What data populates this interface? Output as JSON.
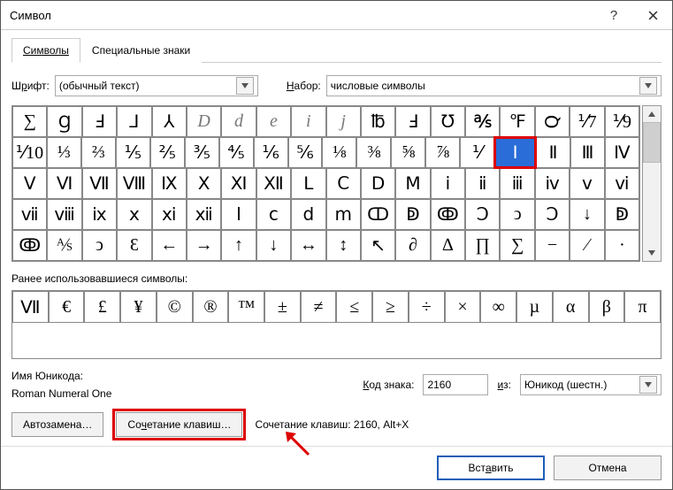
{
  "title": "Символ",
  "tabs": [
    "Символы",
    "Специальные знаки"
  ],
  "font_label_pre": "Ш",
  "font_label_u": "р",
  "font_label_post": "ифт:",
  "font_value": "(обычный текст)",
  "set_label_pre": "",
  "set_label_u": "Н",
  "set_label_post": "абор:",
  "set_value": "числовые символы",
  "grid": [
    [
      "∑",
      "Ɡ",
      "Ⅎ",
      "⅃",
      "⅄",
      "D",
      "d",
      "e",
      "i",
      "j",
      "℔",
      "Ⅎ",
      "℧",
      "℁",
      "℉",
      "℺",
      "⅟7",
      "⅟9"
    ],
    [
      "⅟10",
      "⅓",
      "⅔",
      "⅕",
      "⅖",
      "⅗",
      "⅘",
      "⅙",
      "⅚",
      "⅛",
      "⅜",
      "⅝",
      "⅞",
      "⅟",
      "Ⅰ",
      "Ⅱ",
      "Ⅲ",
      "Ⅳ"
    ],
    [
      "Ⅴ",
      "Ⅵ",
      "Ⅶ",
      "Ⅷ",
      "Ⅸ",
      "Ⅹ",
      "Ⅺ",
      "Ⅻ",
      "Ⅼ",
      "Ⅽ",
      "Ⅾ",
      "Ⅿ",
      "ⅰ",
      "ⅱ",
      "ⅲ",
      "ⅳ",
      "ⅴ",
      "ⅵ"
    ],
    [
      "ⅶ",
      "ⅷ",
      "ⅸ",
      "ⅹ",
      "ⅺ",
      "ⅻ",
      "ⅼ",
      "ⅽ",
      "ⅾ",
      "ⅿ",
      "ↀ",
      "ↁ",
      "ↂ",
      "Ↄ",
      "ↄ",
      "Ↄ",
      "↓",
      "ↁ"
    ],
    [
      "ↂ",
      "⅍",
      "ↄ",
      "Ɛ",
      "←",
      "→",
      "↑",
      "↓",
      "↔",
      "↕",
      "↖",
      "∂",
      "∆",
      "∏",
      "∑",
      "−",
      "∕",
      "∙"
    ]
  ],
  "selected_rc": [
    1,
    14
  ],
  "italic_rc": [
    [
      0,
      5
    ],
    [
      0,
      6
    ],
    [
      0,
      7
    ],
    [
      0,
      8
    ],
    [
      0,
      9
    ]
  ],
  "recent_label": "Ранее использовавшиеся символы:",
  "recent": [
    "Ⅶ",
    "€",
    "£",
    "¥",
    "©",
    "®",
    "™",
    "±",
    "≠",
    "≤",
    "≥",
    "÷",
    "×",
    "∞",
    "µ",
    "α",
    "β",
    "π"
  ],
  "unicode_name_label": "Имя Юникода:",
  "unicode_name_value": "Roman Numeral One",
  "code_label_u": "К",
  "code_label_post": "од знака:",
  "code_value": "2160",
  "from_label_u": "и",
  "from_label_post": "з:",
  "from_value": "Юникод (шестн.)",
  "btn_auto": "Автозамена…",
  "btn_short_pre": "Со",
  "btn_short_u": "ч",
  "btn_short_post": "етание клавиш…",
  "shortcut_text": "Сочетание клавиш: 2160, Alt+X",
  "btn_insert": "Вст",
  "btn_insert_u": "а",
  "btn_insert_post": "вить",
  "btn_cancel": "Отмена"
}
